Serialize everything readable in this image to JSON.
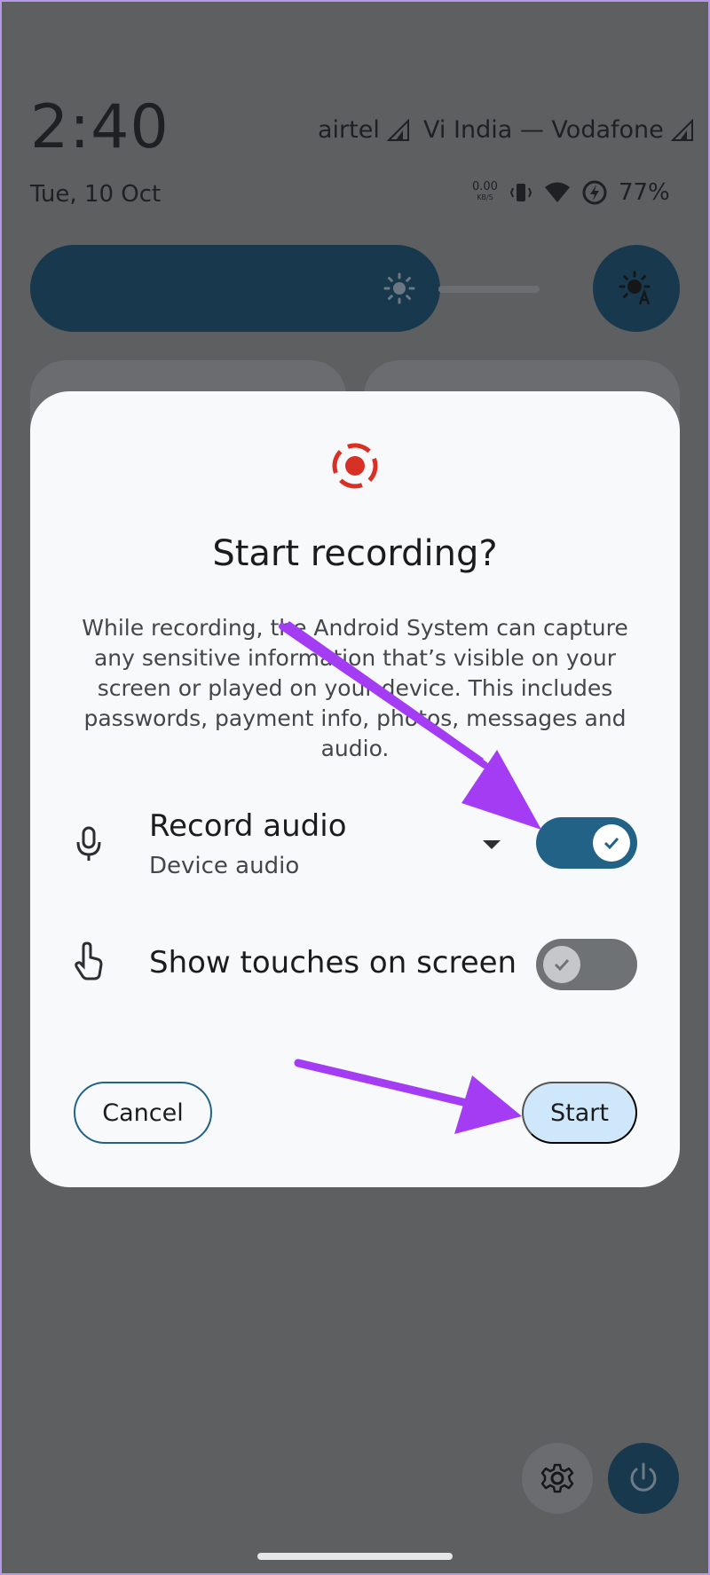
{
  "status_bar": {
    "time": "2:40",
    "date": "Tue, 10 Oct",
    "carrier_1": "airtel",
    "carrier_2": "Vi India — Vodafone",
    "net_speed_value": "0.00",
    "net_speed_unit": "KB/S",
    "battery": "77%"
  },
  "icons": {
    "brightness": "sun-icon",
    "auto_brightness": "auto-brightness-icon",
    "record": "screen-record-icon",
    "mic": "microphone-icon",
    "touch": "touch-hand-icon",
    "settings": "gear-icon",
    "power": "power-icon"
  },
  "dialog": {
    "title": "Start recording?",
    "description": "While recording, the Android System can capture any sensitive information that’s visible on your screen or played on your device. This includes passwords, payment info, photos, messages and audio.",
    "record_audio": {
      "label": "Record audio",
      "source": "Device audio",
      "enabled": true
    },
    "show_touches": {
      "label": "Show touches on screen",
      "enabled": false
    },
    "cancel_label": "Cancel",
    "start_label": "Start"
  },
  "colors": {
    "accent": "#226286",
    "annotation_arrow": "#a43cf3",
    "record_red": "#d93025"
  }
}
